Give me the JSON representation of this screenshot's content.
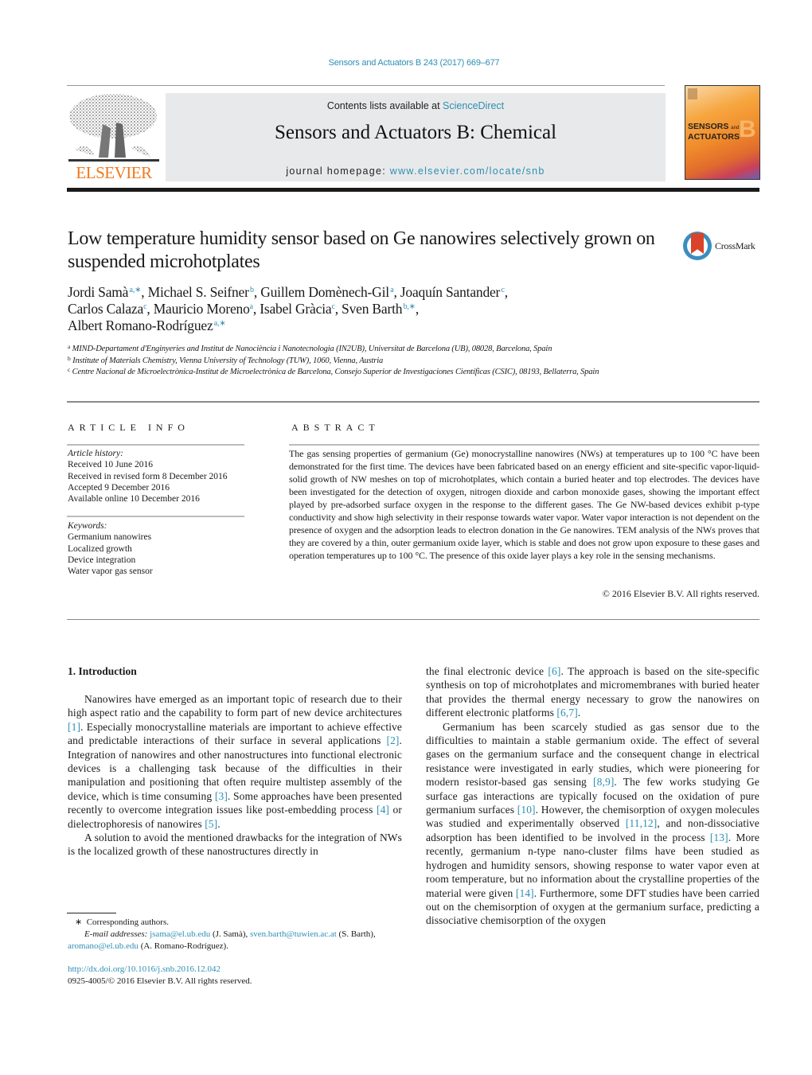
{
  "header": {
    "journal_ref": "Sensors and Actuators B 243 (2017) 669–677",
    "contents_prefix": "Contents lists available at ",
    "contents_link": "ScienceDirect",
    "journal_title": "Sensors and Actuators B: Chemical",
    "homepage_prefix": "journal homepage: ",
    "homepage_link": "www.elsevier.com/locate/snb",
    "publisher_logo_text": "ELSEVIER",
    "cover_line1": "SENSORS",
    "cover_and": "and",
    "cover_line2": "ACTUATORS",
    "cover_letter": "B",
    "colors": {
      "link": "#2e8fb4",
      "elsevier_orange": "#f0781e",
      "banner_bg": "#e8e9ea"
    }
  },
  "article": {
    "title": "Low temperature humidity sensor based on Ge nanowires selectively grown on suspended microhotplates",
    "crossmark_label": "CrossMark",
    "authors": [
      {
        "name": "Jordi Samà",
        "sup": "a,∗",
        "sep": ", "
      },
      {
        "name": "Michael S. Seifner",
        "sup": "b",
        "sep": ", "
      },
      {
        "name": "Guillem Domènech-Gil",
        "sup": "a",
        "sep": ", "
      },
      {
        "name": "Joaquín Santander",
        "sup": "c",
        "sep": ","
      },
      {
        "name": "Carlos Calaza",
        "sup": "c",
        "sep": ", "
      },
      {
        "name": "Mauricio Moreno",
        "sup": "a",
        "sep": ", "
      },
      {
        "name": "Isabel Gràcia",
        "sup": "c",
        "sep": ", "
      },
      {
        "name": "Sven Barth",
        "sup": "b,∗",
        "sep": ","
      },
      {
        "name": "Albert Romano-Rodríguez",
        "sup": "a,∗",
        "sep": ""
      }
    ],
    "affiliations": [
      {
        "key": "a",
        "text": "MIND-Departament d'Enginyeries and Institut de Nanociència i Nanotecnologia (IN2UB), Universitat de Barcelona (UB), 08028, Barcelona, Spain"
      },
      {
        "key": "b",
        "text": "Institute of Materials Chemistry, Vienna University of Technology (TUW), 1060, Vienna, Austria"
      },
      {
        "key": "c",
        "text": "Centre Nacional de Microelectrònica-Institut de Microelectrònica de Barcelona, Consejo Superior de Investigaciones Científicas (CSIC), 08193, Bellaterra, Spain"
      }
    ]
  },
  "article_info": {
    "heading": "ARTICLE INFO",
    "history_label": "Article history:",
    "history": [
      "Received 10 June 2016",
      "Received in revised form 8 December 2016",
      "Accepted 9 December 2016",
      "Available online 10 December 2016"
    ],
    "keywords_label": "Keywords:",
    "keywords": [
      "Germanium nanowires",
      "Localized growth",
      "Device integration",
      "Water vapor gas sensor"
    ]
  },
  "abstract": {
    "heading": "ABSTRACT",
    "text": "The gas sensing properties of germanium (Ge) monocrystalline nanowires (NWs) at temperatures up to 100 °C have been demonstrated for the first time. The devices have been fabricated based on an energy efficient and site-specific vapor-liquid-solid growth of NW meshes on top of microhotplates, which contain a buried heater and top electrodes. The devices have been investigated for the detection of oxygen, nitrogen dioxide and carbon monoxide gases, showing the important effect played by pre-adsorbed surface oxygen in the response to the different gases. The Ge NW-based devices exhibit p-type conductivity and show high selectivity in their response towards water vapor. Water vapor interaction is not dependent on the presence of oxygen and the adsorption leads to electron donation in the Ge nanowires. TEM analysis of the NWs proves that they are covered by a thin, outer germanium oxide layer, which is stable and does not grow upon exposure to these gases and operation temperatures up to 100 °C. The presence of this oxide layer plays a key role in the sensing mechanisms.",
    "copyright": "© 2016 Elsevier B.V. All rights reserved."
  },
  "body": {
    "section_heading": "1.  Introduction",
    "left": {
      "p1": [
        {
          "t": "Nanowires have emerged as an important topic of research due to their high aspect ratio and the capability to form part of new device architectures "
        },
        {
          "c": "[1]"
        },
        {
          "t": ". Especially monocrystalline materials are important to achieve effective and predictable interactions of their surface in several applications "
        },
        {
          "c": "[2]"
        },
        {
          "t": ". Integration of nanowires and other nanostructures into functional electronic devices is a challenging task because of the difficulties in their manipulation and positioning that often require multistep assembly of the device, which is time consuming "
        },
        {
          "c": "[3]"
        },
        {
          "t": ". Some approaches have been presented recently to overcome integration issues like post-embedding process "
        },
        {
          "c": "[4]"
        },
        {
          "t": " or dielectrophoresis of nanowires "
        },
        {
          "c": "[5]"
        },
        {
          "t": "."
        }
      ],
      "p2": [
        {
          "t": "A solution to avoid the mentioned drawbacks for the integration of NWs is the localized growth of these nanostructures directly in"
        }
      ]
    },
    "right": {
      "p1": [
        {
          "t": "the final electronic device "
        },
        {
          "c": "[6]"
        },
        {
          "t": ". The approach is based on the site-specific synthesis on top of microhotplates and micromembranes with buried heater that provides the thermal energy necessary to grow the nanowires on different electronic platforms "
        },
        {
          "c": "[6,7]"
        },
        {
          "t": "."
        }
      ],
      "p2": [
        {
          "t": "Germanium has been scarcely studied as gas sensor due to the difficulties to maintain a stable germanium oxide. The effect of several gases on the germanium surface and the consequent change in electrical resistance were investigated in early studies, which were pioneering for modern resistor-based gas sensing "
        },
        {
          "c": "[8,9]"
        },
        {
          "t": ". The few works studying Ge surface gas interactions are typically focused on the oxidation of pure germanium surfaces "
        },
        {
          "c": "[10]"
        },
        {
          "t": ". However, the chemisorption of oxygen molecules was studied and experimentally observed "
        },
        {
          "c": "[11,12]"
        },
        {
          "t": ", and non-dissociative adsorption has been identified to be involved in the process "
        },
        {
          "c": "[13]"
        },
        {
          "t": ". More recently, germanium n-type nano-cluster films have been studied as hydrogen and humidity sensors, showing response to water vapor even at room temperature, but no information about the crystalline properties of the material were given "
        },
        {
          "c": "[14]"
        },
        {
          "t": ". Furthermore, some DFT studies have been carried out on the chemisorption of oxygen at the germanium surface, predicting a dissociative chemisorption of the oxygen"
        }
      ]
    }
  },
  "footnotes": {
    "corresponding_mark": "∗",
    "corresponding_text": "Corresponding authors.",
    "email_label": "E-mail addresses:",
    "emails": [
      {
        "email": "jsama@el.ub.edu",
        "who": "(J. Samà)"
      },
      {
        "email": "sven.barth@tuwien.ac.at",
        "who": "(S. Barth)"
      },
      {
        "email": "aromano@el.ub.edu",
        "who": "(A. Romano-Rodríguez)"
      }
    ],
    "doi": "http://dx.doi.org/10.1016/j.snb.2016.12.042",
    "issn_copyright": "0925-4005/© 2016 Elsevier B.V. All rights reserved."
  }
}
